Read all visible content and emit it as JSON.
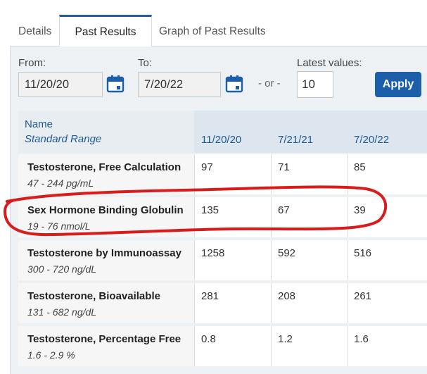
{
  "tabs": {
    "details": "Details",
    "past_results": "Past Results",
    "graph": "Graph of Past Results"
  },
  "filters": {
    "from_label": "From:",
    "from_value": "11/20/20",
    "to_label": "To:",
    "to_value": "7/20/22",
    "or_text": "- or -",
    "latest_label": "Latest values:",
    "latest_value": "10",
    "apply_label": "Apply"
  },
  "table": {
    "header_name": "Name",
    "header_range": "Standard Range",
    "dates": [
      "11/20/20",
      "7/21/21",
      "7/20/22"
    ],
    "rows": [
      {
        "name": "Testosterone, Free Calculation",
        "range": "47 - 244 pg/mL",
        "values": [
          "97",
          "71",
          "85"
        ]
      },
      {
        "name": "Sex Hormone Binding Globulin",
        "range": "19 - 76 nmol/L",
        "values": [
          "135",
          "67",
          "39"
        ]
      },
      {
        "name": "Testosterone by Immunoassay",
        "range": "300 - 720 ng/dL",
        "values": [
          "1258",
          "592",
          "516"
        ]
      },
      {
        "name": "Testosterone, Bioavailable",
        "range": "131 - 682 ng/dL",
        "values": [
          "281",
          "208",
          "261"
        ]
      },
      {
        "name": "Testosterone, Percentage Free",
        "range": "1.6 - 2.9 %",
        "values": [
          "0.8",
          "1.2",
          "1.6"
        ]
      }
    ]
  },
  "colors": {
    "accent": "#1c5fa8",
    "annotation": "#d81b1b"
  }
}
